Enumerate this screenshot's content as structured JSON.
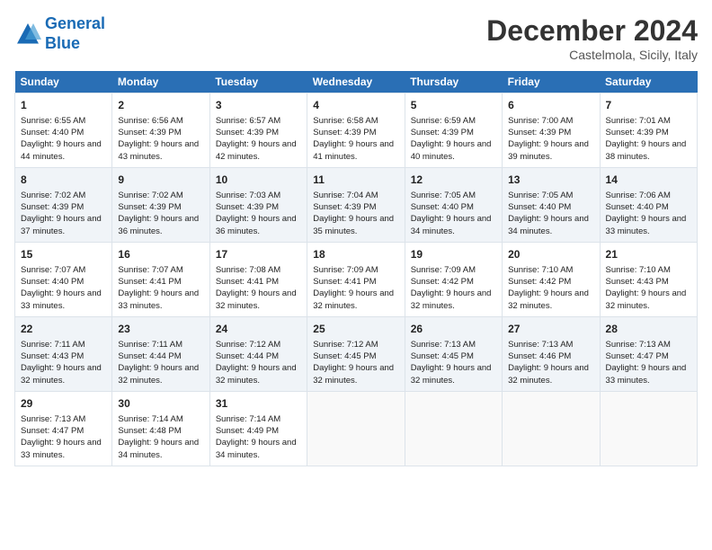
{
  "logo": {
    "line1": "General",
    "line2": "Blue"
  },
  "title": "December 2024",
  "location": "Castelmola, Sicily, Italy",
  "weekdays": [
    "Sunday",
    "Monday",
    "Tuesday",
    "Wednesday",
    "Thursday",
    "Friday",
    "Saturday"
  ],
  "weeks": [
    [
      {
        "day": "1",
        "sunrise": "Sunrise: 6:55 AM",
        "sunset": "Sunset: 4:40 PM",
        "daylight": "Daylight: 9 hours and 44 minutes."
      },
      {
        "day": "2",
        "sunrise": "Sunrise: 6:56 AM",
        "sunset": "Sunset: 4:39 PM",
        "daylight": "Daylight: 9 hours and 43 minutes."
      },
      {
        "day": "3",
        "sunrise": "Sunrise: 6:57 AM",
        "sunset": "Sunset: 4:39 PM",
        "daylight": "Daylight: 9 hours and 42 minutes."
      },
      {
        "day": "4",
        "sunrise": "Sunrise: 6:58 AM",
        "sunset": "Sunset: 4:39 PM",
        "daylight": "Daylight: 9 hours and 41 minutes."
      },
      {
        "day": "5",
        "sunrise": "Sunrise: 6:59 AM",
        "sunset": "Sunset: 4:39 PM",
        "daylight": "Daylight: 9 hours and 40 minutes."
      },
      {
        "day": "6",
        "sunrise": "Sunrise: 7:00 AM",
        "sunset": "Sunset: 4:39 PM",
        "daylight": "Daylight: 9 hours and 39 minutes."
      },
      {
        "day": "7",
        "sunrise": "Sunrise: 7:01 AM",
        "sunset": "Sunset: 4:39 PM",
        "daylight": "Daylight: 9 hours and 38 minutes."
      }
    ],
    [
      {
        "day": "8",
        "sunrise": "Sunrise: 7:02 AM",
        "sunset": "Sunset: 4:39 PM",
        "daylight": "Daylight: 9 hours and 37 minutes."
      },
      {
        "day": "9",
        "sunrise": "Sunrise: 7:02 AM",
        "sunset": "Sunset: 4:39 PM",
        "daylight": "Daylight: 9 hours and 36 minutes."
      },
      {
        "day": "10",
        "sunrise": "Sunrise: 7:03 AM",
        "sunset": "Sunset: 4:39 PM",
        "daylight": "Daylight: 9 hours and 36 minutes."
      },
      {
        "day": "11",
        "sunrise": "Sunrise: 7:04 AM",
        "sunset": "Sunset: 4:39 PM",
        "daylight": "Daylight: 9 hours and 35 minutes."
      },
      {
        "day": "12",
        "sunrise": "Sunrise: 7:05 AM",
        "sunset": "Sunset: 4:40 PM",
        "daylight": "Daylight: 9 hours and 34 minutes."
      },
      {
        "day": "13",
        "sunrise": "Sunrise: 7:05 AM",
        "sunset": "Sunset: 4:40 PM",
        "daylight": "Daylight: 9 hours and 34 minutes."
      },
      {
        "day": "14",
        "sunrise": "Sunrise: 7:06 AM",
        "sunset": "Sunset: 4:40 PM",
        "daylight": "Daylight: 9 hours and 33 minutes."
      }
    ],
    [
      {
        "day": "15",
        "sunrise": "Sunrise: 7:07 AM",
        "sunset": "Sunset: 4:40 PM",
        "daylight": "Daylight: 9 hours and 33 minutes."
      },
      {
        "day": "16",
        "sunrise": "Sunrise: 7:07 AM",
        "sunset": "Sunset: 4:41 PM",
        "daylight": "Daylight: 9 hours and 33 minutes."
      },
      {
        "day": "17",
        "sunrise": "Sunrise: 7:08 AM",
        "sunset": "Sunset: 4:41 PM",
        "daylight": "Daylight: 9 hours and 32 minutes."
      },
      {
        "day": "18",
        "sunrise": "Sunrise: 7:09 AM",
        "sunset": "Sunset: 4:41 PM",
        "daylight": "Daylight: 9 hours and 32 minutes."
      },
      {
        "day": "19",
        "sunrise": "Sunrise: 7:09 AM",
        "sunset": "Sunset: 4:42 PM",
        "daylight": "Daylight: 9 hours and 32 minutes."
      },
      {
        "day": "20",
        "sunrise": "Sunrise: 7:10 AM",
        "sunset": "Sunset: 4:42 PM",
        "daylight": "Daylight: 9 hours and 32 minutes."
      },
      {
        "day": "21",
        "sunrise": "Sunrise: 7:10 AM",
        "sunset": "Sunset: 4:43 PM",
        "daylight": "Daylight: 9 hours and 32 minutes."
      }
    ],
    [
      {
        "day": "22",
        "sunrise": "Sunrise: 7:11 AM",
        "sunset": "Sunset: 4:43 PM",
        "daylight": "Daylight: 9 hours and 32 minutes."
      },
      {
        "day": "23",
        "sunrise": "Sunrise: 7:11 AM",
        "sunset": "Sunset: 4:44 PM",
        "daylight": "Daylight: 9 hours and 32 minutes."
      },
      {
        "day": "24",
        "sunrise": "Sunrise: 7:12 AM",
        "sunset": "Sunset: 4:44 PM",
        "daylight": "Daylight: 9 hours and 32 minutes."
      },
      {
        "day": "25",
        "sunrise": "Sunrise: 7:12 AM",
        "sunset": "Sunset: 4:45 PM",
        "daylight": "Daylight: 9 hours and 32 minutes."
      },
      {
        "day": "26",
        "sunrise": "Sunrise: 7:13 AM",
        "sunset": "Sunset: 4:45 PM",
        "daylight": "Daylight: 9 hours and 32 minutes."
      },
      {
        "day": "27",
        "sunrise": "Sunrise: 7:13 AM",
        "sunset": "Sunset: 4:46 PM",
        "daylight": "Daylight: 9 hours and 32 minutes."
      },
      {
        "day": "28",
        "sunrise": "Sunrise: 7:13 AM",
        "sunset": "Sunset: 4:47 PM",
        "daylight": "Daylight: 9 hours and 33 minutes."
      }
    ],
    [
      {
        "day": "29",
        "sunrise": "Sunrise: 7:13 AM",
        "sunset": "Sunset: 4:47 PM",
        "daylight": "Daylight: 9 hours and 33 minutes."
      },
      {
        "day": "30",
        "sunrise": "Sunrise: 7:14 AM",
        "sunset": "Sunset: 4:48 PM",
        "daylight": "Daylight: 9 hours and 34 minutes."
      },
      {
        "day": "31",
        "sunrise": "Sunrise: 7:14 AM",
        "sunset": "Sunset: 4:49 PM",
        "daylight": "Daylight: 9 hours and 34 minutes."
      },
      null,
      null,
      null,
      null
    ]
  ]
}
